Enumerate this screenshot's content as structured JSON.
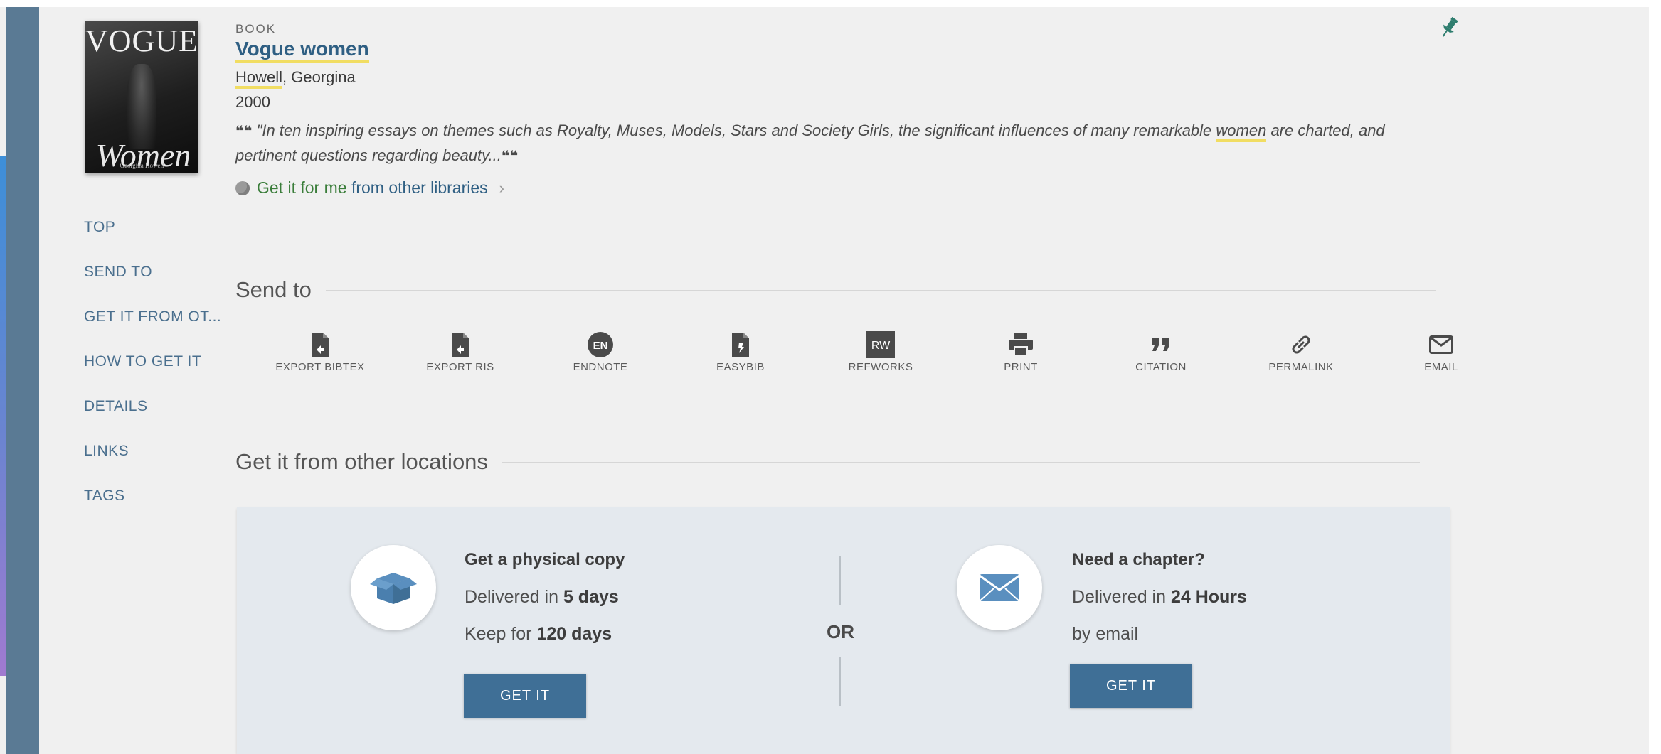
{
  "record": {
    "type": "BOOK",
    "title": "Vogue women",
    "author_surname": "Howell",
    "author_rest": ", Georgina",
    "year": "2000",
    "snippet_before": "\"In ten inspiring essays on themes such as Royalty, Muses, Models, Stars and Society Girls, the significant influences of many remarkable ",
    "snippet_highlight": "women",
    "snippet_after": " are charted, and pertinent questions regarding beauty...",
    "get_it_for_me": "Get it for me",
    "from_other_libraries": "from other libraries",
    "cover": {
      "title": "VOGUE",
      "subtitle": "Women",
      "author": "Georgina Howell"
    }
  },
  "side_nav": [
    "TOP",
    "SEND TO",
    "GET IT FROM OT...",
    "HOW TO GET IT",
    "DETAILS",
    "LINKS",
    "TAGS"
  ],
  "send_to": {
    "heading": "Send to",
    "actions": [
      {
        "label": "EXPORT BIBTEX",
        "icon": "file-export-icon"
      },
      {
        "label": "EXPORT RIS",
        "icon": "file-export-icon"
      },
      {
        "label": "ENDNOTE",
        "icon": "endnote-icon",
        "badge": "EN"
      },
      {
        "label": "EASYBIB",
        "icon": "easybib-icon"
      },
      {
        "label": "REFWORKS",
        "icon": "refworks-icon",
        "badge": "RW"
      },
      {
        "label": "PRINT",
        "icon": "print-icon"
      },
      {
        "label": "CITATION",
        "icon": "quote-icon"
      },
      {
        "label": "PERMALINK",
        "icon": "link-icon"
      },
      {
        "label": "EMAIL",
        "icon": "envelope-icon"
      }
    ]
  },
  "get_it": {
    "heading": "Get it from other locations",
    "physical": {
      "title": "Get a physical copy",
      "delivered_prefix": "Delivered in ",
      "delivered_value": "5 days",
      "keep_prefix": "Keep for ",
      "keep_value": "120 days",
      "button": "GET IT"
    },
    "or_label": "OR",
    "chapter": {
      "title": "Need a chapter?",
      "delivered_prefix": "Delivered in ",
      "delivered_value": "24 Hours",
      "by_email": "by email",
      "button": "GET IT"
    }
  },
  "colors": {
    "link": "#2f5f83",
    "green_link": "#3a7d3a",
    "highlight": "#f1dd62",
    "button": "#3f6f96",
    "pin": "#2e7d6e"
  }
}
